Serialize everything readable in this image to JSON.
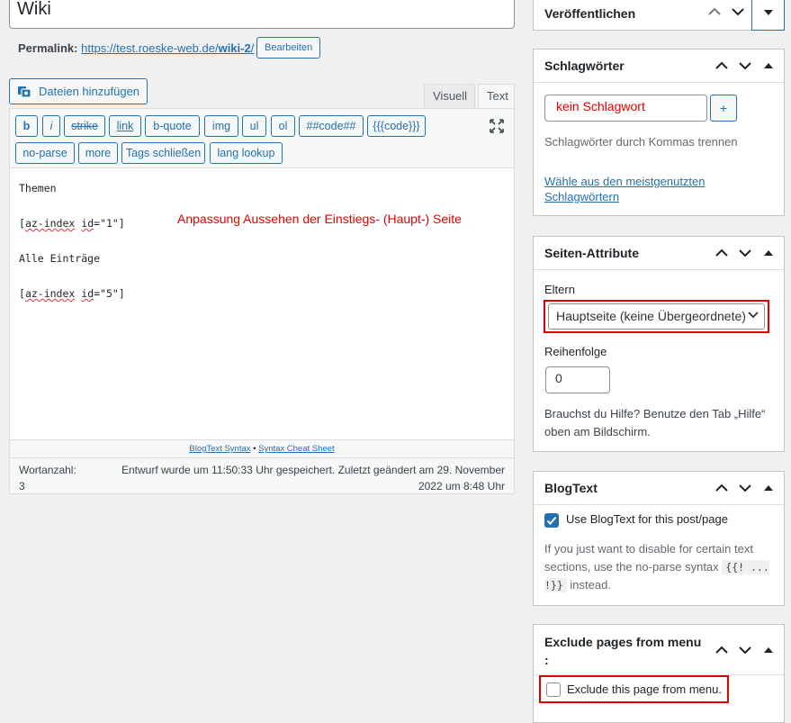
{
  "title": {
    "value": "Wiki"
  },
  "permalink": {
    "label": "Permalink:",
    "url_base": "https://test.roeske-web.de/",
    "slug": "wiki-2",
    "url_end": "/",
    "edit_button": "Bearbeiten"
  },
  "media": {
    "add_button": "Dateien hinzufügen"
  },
  "editor": {
    "tabs": [
      "Visuell",
      "Text"
    ],
    "active_tab": "Text",
    "toolbar": [
      "b",
      "i",
      "strike",
      "link",
      "b-quote",
      "img",
      "ul",
      "ol",
      "##code##",
      "{{{code}}}",
      "no-parse",
      "more",
      "Tags schließen",
      "lang lookup"
    ],
    "lines": {
      "l1": "Themen",
      "l2_pre": "[",
      "l2_sp1": "az-index",
      "l2_mid": " ",
      "l2_sp2": "id",
      "l2_post": "=\"1\"]",
      "l3": "Alle Einträge",
      "l4_pre": "[",
      "l4_sp1": "az-index",
      "l4_mid": " ",
      "l4_sp2": "id",
      "l4_post": "=\"5\"]"
    },
    "annotation": "Anpassung Aussehen der Einstiegs- (Haupt-) Seite",
    "syntax_link1": "BlogText Syntax",
    "syntax_sep": " • ",
    "syntax_link2": "Syntax Cheat Sheet",
    "wordcount_label": "Wortanzahl:",
    "wordcount": "3",
    "autosave": "Entwurf wurde um 11:50:33 Uhr gespeichert. Zuletzt geändert am 29. November 2022 um 8:48 Uhr"
  },
  "sidebar": {
    "publish": {
      "title": "Veröffentlichen"
    },
    "tags": {
      "title": "Schlagwörter",
      "input_value": "kein Schlagwort",
      "add_button": "+",
      "hint": "Schlagwörter durch Kommas trennen",
      "popular_link": "Wähle aus den meistgenutzten Schlagwörtern"
    },
    "attributes": {
      "title": "Seiten-Attribute",
      "parent_label": "Eltern",
      "parent_value": "Hauptseite (keine Übergeordnete)",
      "order_label": "Reihenfolge",
      "order_value": "0",
      "help": "Brauchst du Hilfe? Benutze den Tab „Hilfe“ oben am Bildschirm."
    },
    "blogtext": {
      "title": "BlogText",
      "checkbox_label": "Use BlogText for this post/page",
      "checked": true,
      "help_pre": "If you just want to disable for certain text sections, use the no-parse syntax ",
      "help_code": "{{! ... !}}",
      "help_post": " instead."
    },
    "exclude": {
      "title": "Exclude pages from menu :",
      "checkbox_label": "Exclude this page from menu.",
      "checked": false
    }
  },
  "colors": {
    "accent": "#2271b1",
    "annotation": "#e60000",
    "highlight_box": "#e00000"
  }
}
